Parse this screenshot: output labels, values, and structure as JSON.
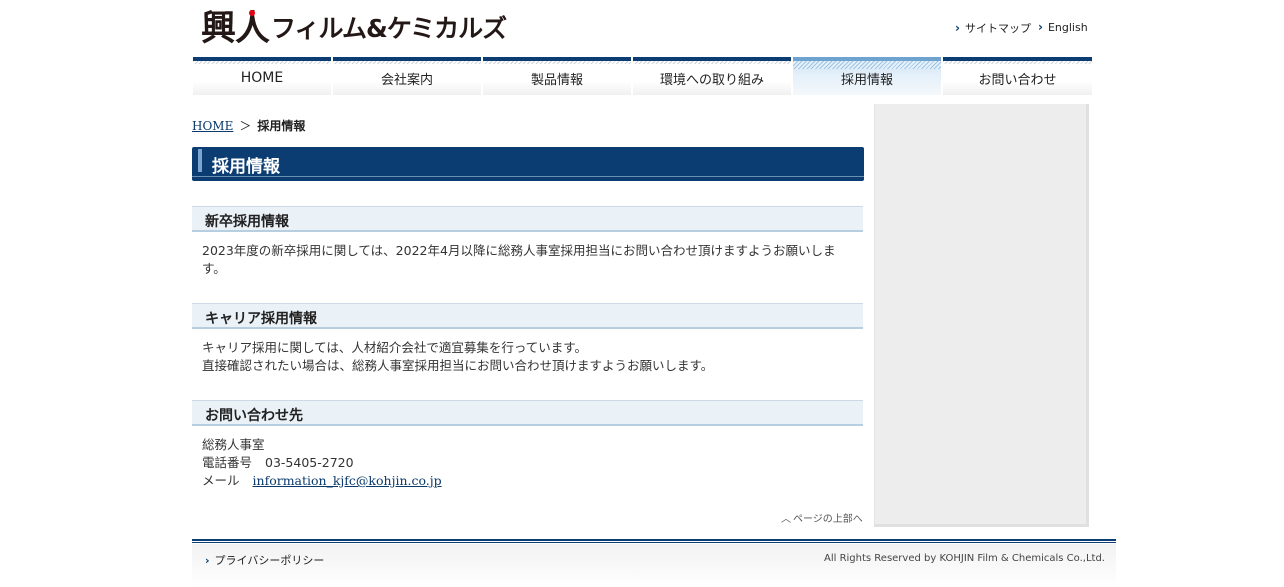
{
  "header": {
    "logo_kanji": "興人",
    "logo_kana": "フィルム&ケミカルズ",
    "links": [
      "サイトマップ",
      "English"
    ]
  },
  "nav": {
    "tabs": [
      "HOME",
      "会社案内",
      "製品情報",
      "環境への取り組み",
      "採用情報",
      "お問い合わせ"
    ],
    "active": "採用情報"
  },
  "breadcrumb": {
    "home": "HOME",
    "separator": "＞",
    "current": "採用情報"
  },
  "page_title": "採用情報",
  "sections": [
    {
      "title": "新卒採用情報",
      "lines": [
        "2023年度の新卒採用に関しては、2022年4月以降に総務人事室採用担当にお問い合わせ頂けますようお願いしま",
        "す。"
      ]
    },
    {
      "title": "キャリア採用情報",
      "lines": [
        "キャリア採用に関しては、人材紹介会社で適宜募集を行っています。",
        "直接確認されたい場合は、総務人事室採用担当にお問い合わせ頂けますようお願いします。"
      ]
    },
    {
      "title": "お問い合わせ先",
      "dept": "総務人事室",
      "phone_label": "電話番号",
      "phone": "03-5405-2720",
      "mail_label": "メール",
      "mail": "information_kjfc@kohjin.co.jp"
    }
  ],
  "to_top": "ページの上部へ",
  "footer": {
    "privacy": "プライバシーポリシー",
    "copyright": "All Rights Reserved by KOHJIN Film & Chemicals Co.,Ltd."
  },
  "colors": {
    "navy": "#0b3d73",
    "section_bg": "#eaf1f7",
    "sidebar_bg": "#ededed"
  },
  "icons": [
    "chevron-right-icon",
    "chevron-up-icon"
  ]
}
